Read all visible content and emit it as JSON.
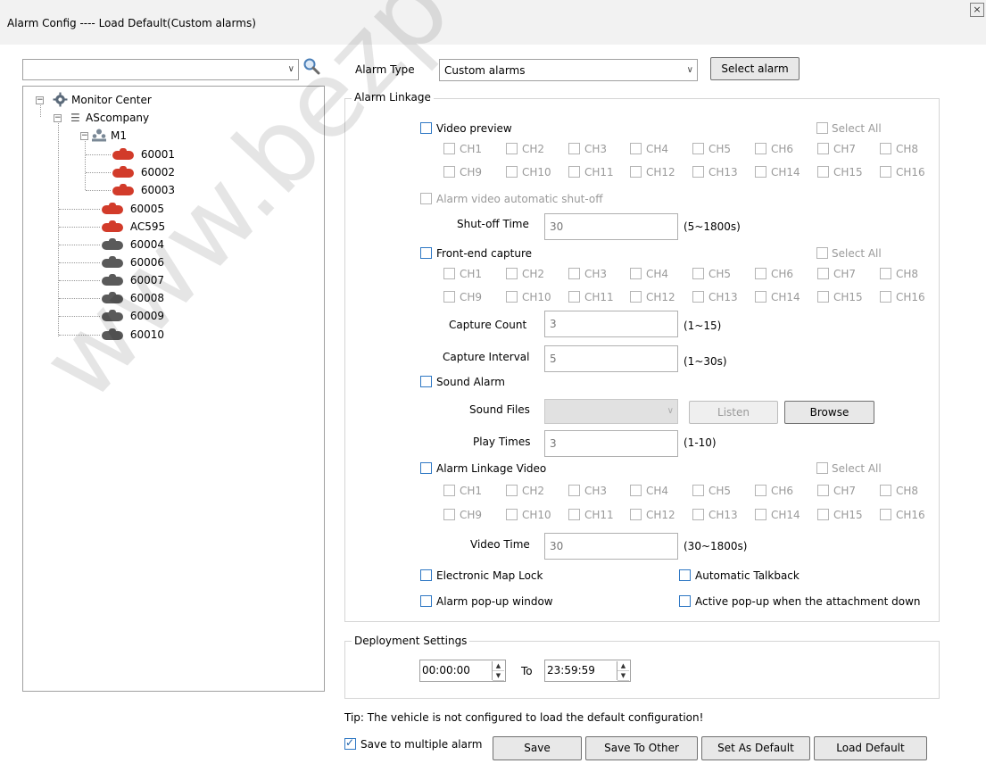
{
  "window": {
    "title": "Alarm Config ---- Load Default(Custom alarms)",
    "close_glyph": "×"
  },
  "search": {
    "value": ""
  },
  "tree": {
    "root": "Monitor Center",
    "company": "AScompany",
    "group": "M1",
    "group_vehicles": [
      "60001",
      "60002",
      "60003"
    ],
    "company_vehicles": [
      "60005",
      "AC595",
      "60004",
      "60006",
      "60007",
      "60008",
      "60009",
      "60010"
    ]
  },
  "alarm_type": {
    "label": "Alarm Type",
    "value": "Custom alarms",
    "select_button": "Select alarm"
  },
  "alarm_linkage": {
    "title": "Alarm Linkage",
    "video_preview": "Video preview",
    "select_all": "Select All",
    "channels_row1": [
      "CH1",
      "CH2",
      "CH3",
      "CH4",
      "CH5",
      "CH6",
      "CH7",
      "CH8"
    ],
    "channels_row2": [
      "CH9",
      "CH10",
      "CH11",
      "CH12",
      "CH13",
      "CH14",
      "CH15",
      "CH16"
    ],
    "auto_shutoff": "Alarm video automatic shut-off",
    "shutoff_label": "Shut-off Time",
    "shutoff_value": "30",
    "shutoff_unit": "(5~1800s)",
    "front_capture": "Front-end capture",
    "capture_count_label": "Capture Count",
    "capture_count_value": "3",
    "capture_count_unit": "(1~15)",
    "capture_interval_label": "Capture Interval",
    "capture_interval_value": "5",
    "capture_interval_unit": "(1~30s)",
    "sound_alarm": "Sound Alarm",
    "sound_files_label": "Sound Files",
    "listen_button": "Listen",
    "browse_button": "Browse",
    "play_times_label": "Play Times",
    "play_times_value": "3",
    "play_times_unit": "(1-10)",
    "linkage_video": "Alarm Linkage Video",
    "video_time_label": "Video Time",
    "video_time_value": "30",
    "video_time_unit": "(30~1800s)",
    "map_lock": "Electronic Map Lock",
    "auto_talkback": "Automatic Talkback",
    "popup_window": "Alarm pop-up window",
    "active_popup": "Active pop-up when the attachment down"
  },
  "deployment": {
    "title": "Deployment Settings",
    "start": "00:00:00",
    "to": "To",
    "end": "23:59:59"
  },
  "tip": "Tip: The vehicle is not configured to load the default configuration!",
  "footer": {
    "save_multiple": "Save to multiple alarm",
    "save_multiple_checked": true,
    "save": "Save",
    "save_to_other": "Save To Other",
    "set_default": "Set As Default",
    "load_default": "Load Default"
  },
  "watermark": "www.bezpeka-shop",
  "colors": {
    "accent": "#2f78c4",
    "vehicle_online": "#d23b2a",
    "vehicle_offline": "#5a5a5a"
  }
}
